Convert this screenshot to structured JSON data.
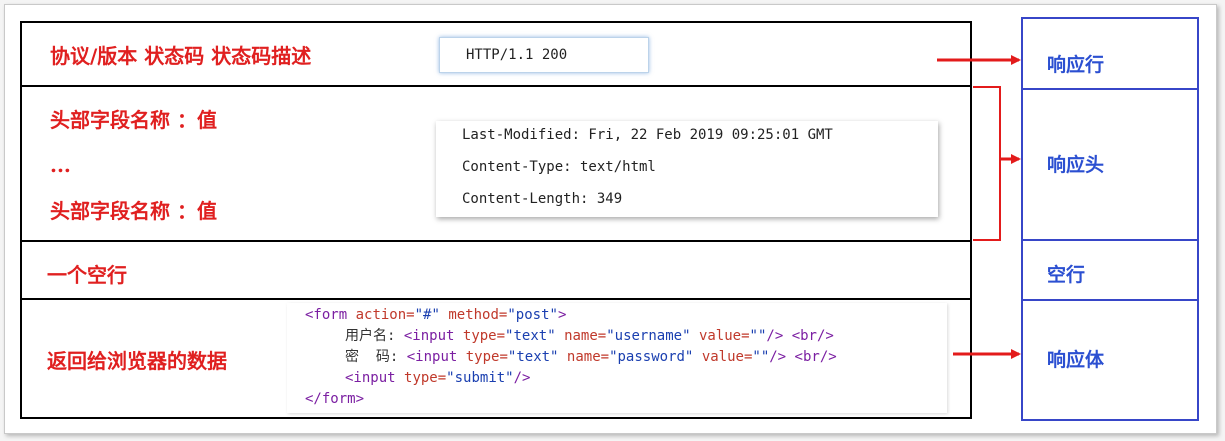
{
  "left": {
    "status_line": {
      "label": "协议/版本   状态码   状态码描述",
      "example": "HTTP/1.1 200"
    },
    "headers": {
      "label_1": "头部字段名称 ：值",
      "ellipsis": "...",
      "label_2": "头部字段名称 ：值",
      "example": [
        "Last-Modified: Fri, 22 Feb 2019 09:25:01 GMT",
        "Content-Type: text/html",
        "Content-Length: 349"
      ]
    },
    "blank_line": {
      "label": "一个空行"
    },
    "body": {
      "label": "返回给浏览器的数据",
      "code": {
        "form_open_tag": "<form",
        "action_attr": "action=",
        "action_val": "\"#\"",
        "method_attr": "method=",
        "method_val": "\"post\"",
        "tag_close": ">",
        "username_label": "用户名:",
        "password_label": "密  码:",
        "input_tag": "<input",
        "type_attr": "type=",
        "text_val": "\"text\"",
        "name_attr": "name=",
        "username_val": "\"username\"",
        "password_val": "\"password\"",
        "value_attr": "value=",
        "empty_val": "\"\"",
        "self_close": "/>",
        "br_tag": "<br/>",
        "submit_val": "\"submit\"",
        "form_close_tag": "</form>"
      }
    }
  },
  "right": {
    "status_line": "响应行",
    "headers": "响应头",
    "blank_line": "空行",
    "body": "响应体"
  },
  "colors": {
    "label_red": "#e02020",
    "right_blue": "#2b4fd1",
    "arrow_red": "#e31b1b",
    "border_blue": "#3746c8"
  }
}
